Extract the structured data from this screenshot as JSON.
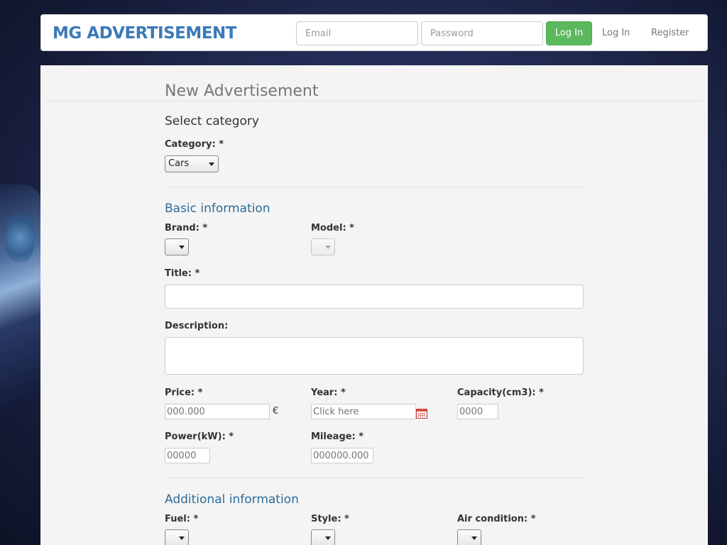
{
  "brand": "MG ADVERTISEMENT",
  "navbar": {
    "email_placeholder": "Email",
    "password_placeholder": "Password",
    "login_button": "Log In",
    "login_link": "Log In",
    "register_link": "Register"
  },
  "page": {
    "title": "New Advertisement",
    "select_category": {
      "heading": "Select category",
      "category_label": "Category: *",
      "category_value": "Cars"
    },
    "basic_information": {
      "heading": "Basic information",
      "brand_label": "Brand: *",
      "brand_value": "",
      "model_label": "Model: *",
      "model_value": "",
      "title_label": "Title: *",
      "title_value": "",
      "description_label": "Description:",
      "description_value": "",
      "price_label": "Price: *",
      "price_placeholder": "000.000",
      "price_currency": "€",
      "year_label": "Year: *",
      "year_placeholder": "Click here",
      "capacity_label": "Capacity(cm3): *",
      "capacity_placeholder": "0000",
      "power_label": "Power(kW): *",
      "power_placeholder": "00000",
      "mileage_label": "Mileage: *",
      "mileage_placeholder": "000000.000"
    },
    "additional_information": {
      "heading": "Additional information",
      "fuel_label": "Fuel: *",
      "style_label": "Style: *",
      "air_condition_label": "Air condition: *"
    }
  },
  "colors": {
    "brand": "#3a7ab8",
    "login_button": "#5cb85c",
    "section_heading": "#2f6b98"
  },
  "icons": {
    "calendar": "calendar-icon",
    "dropdown": "chevron-down-icon"
  }
}
